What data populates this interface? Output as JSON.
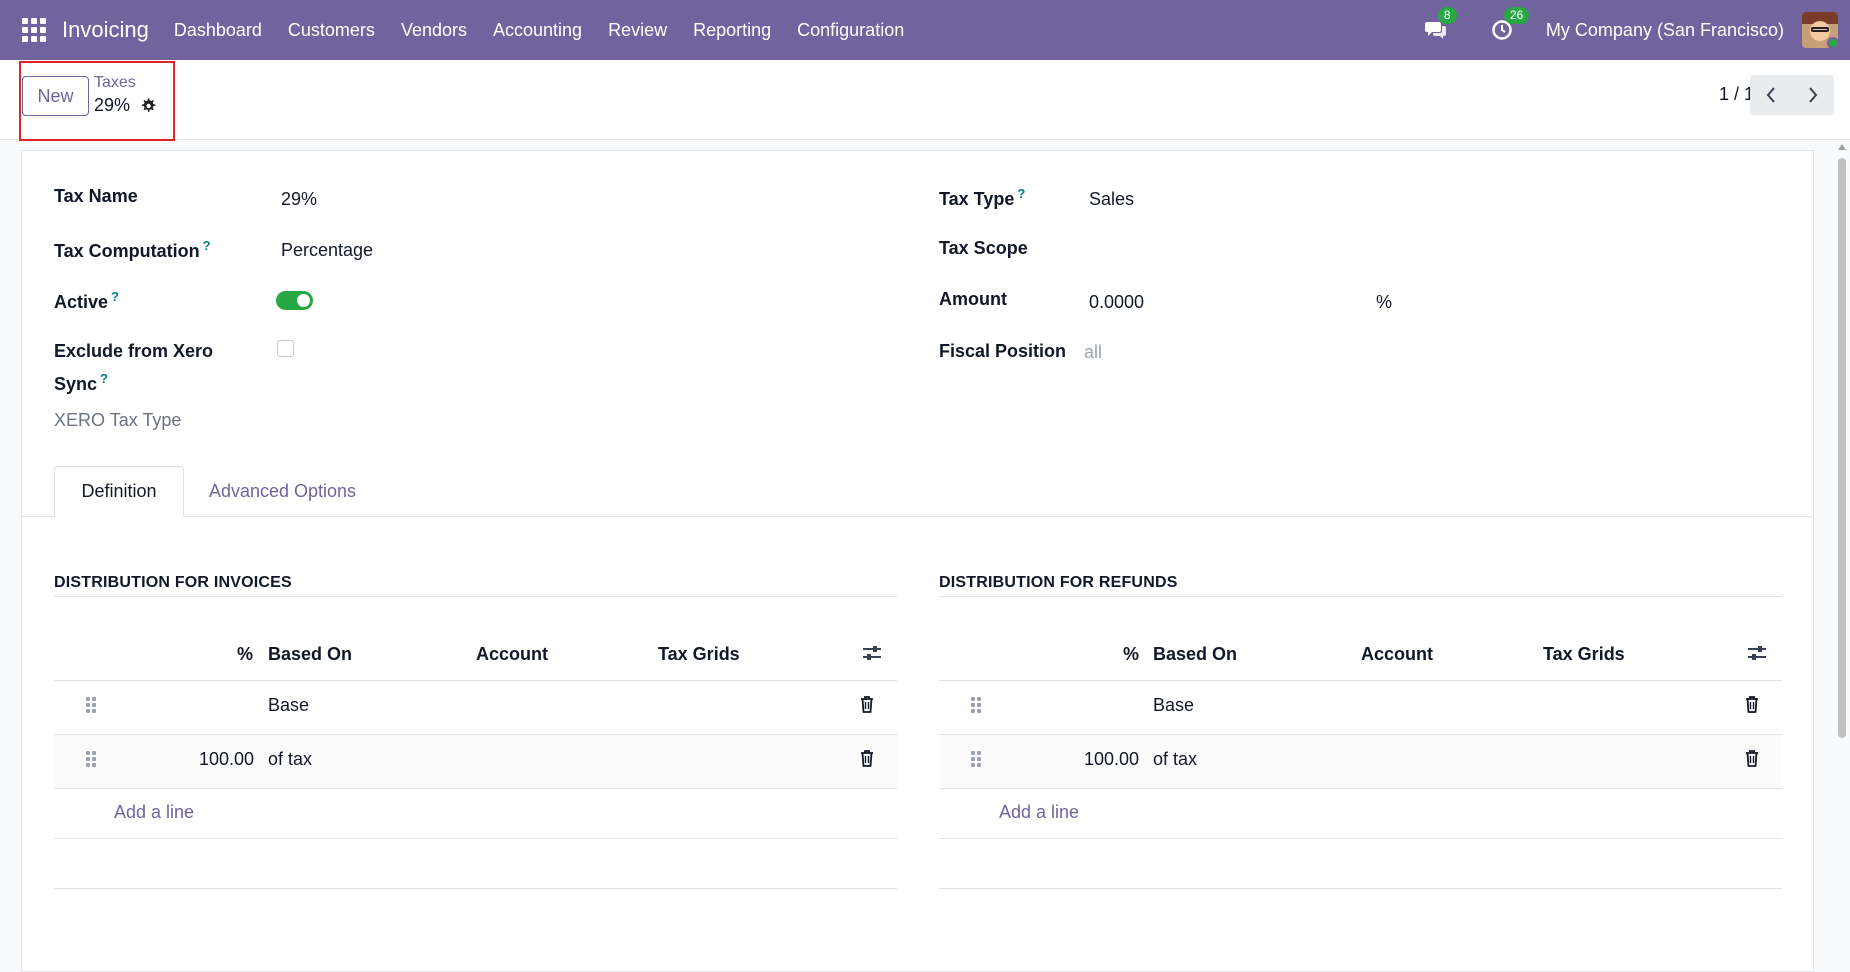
{
  "topbar": {
    "app_title": "Invoicing",
    "menu": [
      "Dashboard",
      "Customers",
      "Vendors",
      "Accounting",
      "Review",
      "Reporting",
      "Configuration"
    ],
    "messages_count": "8",
    "activities_count": "26",
    "company": "My Company (San Francisco)",
    "accent_color": "#71639e"
  },
  "control": {
    "new_label": "New",
    "breadcrumb_parent": "Taxes",
    "breadcrumb_current": "29%",
    "pager": "1 / 1"
  },
  "form": {
    "tax_name_label": "Tax Name",
    "tax_name_value": "29%",
    "tax_computation_label": "Tax Computation",
    "tax_computation_value": "Percentage",
    "active_label": "Active",
    "active_value": true,
    "exclude_xero_label_line1": "Exclude from Xero",
    "exclude_xero_label_line2": "Sync",
    "exclude_xero_value": false,
    "xero_tax_type_label": "XERO Tax Type",
    "tax_type_label": "Tax Type",
    "tax_type_value": "Sales",
    "tax_scope_label": "Tax Scope",
    "amount_label": "Amount",
    "amount_value": "0.0000",
    "amount_unit": "%",
    "fiscal_position_label": "Fiscal Position",
    "fiscal_position_placeholder": "all",
    "help_mark": "?"
  },
  "tabs": {
    "definition": "Definition",
    "advanced": "Advanced Options"
  },
  "invoices": {
    "title": "DISTRIBUTION FOR INVOICES",
    "headers": [
      "%",
      "Based On",
      "Account",
      "Tax Grids"
    ],
    "rows": [
      {
        "percent": "",
        "based_on": "Base"
      },
      {
        "percent": "100.00",
        "based_on": "of tax"
      }
    ],
    "add_line": "Add a line"
  },
  "refunds": {
    "title": "DISTRIBUTION FOR REFUNDS",
    "headers": [
      "%",
      "Based On",
      "Account",
      "Tax Grids"
    ],
    "rows": [
      {
        "percent": "",
        "based_on": "Base"
      },
      {
        "percent": "100.00",
        "based_on": "of tax"
      }
    ],
    "add_line": "Add a line"
  }
}
